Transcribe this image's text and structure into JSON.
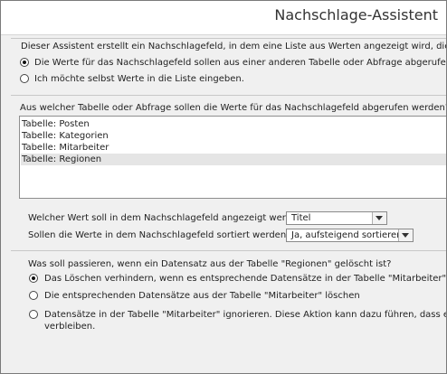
{
  "window": {
    "title": "Nachschlage-Assistent"
  },
  "intro": {
    "text": "Dieser Assistent erstellt ein Nachschlagefeld, in dem eine Liste aus Werten angezeigt wird, die Sie",
    "options": [
      {
        "label": "Die Werte für das Nachschlagefeld sollen aus einer anderen Tabelle oder Abfrage abgerufen werden.",
        "checked": true
      },
      {
        "label": "Ich möchte selbst Werte in die Liste eingeben.",
        "checked": false
      }
    ]
  },
  "source": {
    "question": "Aus welcher Tabelle oder Abfrage sollen die Werte für das Nachschlagefeld abgerufen werden?",
    "items": [
      "Tabelle: Posten",
      "Tabelle: Kategorien",
      "Tabelle: Mitarbeiter",
      "Tabelle: Regionen"
    ],
    "selected_index": 3
  },
  "display": {
    "value_label": "Welcher Wert soll in dem Nachschlagefeld angezeigt werden?",
    "value_selected": "Titel",
    "sort_label": "Sollen die Werte in dem Nachschlagefeld sortiert werden?",
    "sort_selected": "Ja, aufsteigend sortieren"
  },
  "delete": {
    "question": "Was soll passieren, wenn ein Datensatz aus der Tabelle \"Regionen\" gelöscht ist?",
    "options": [
      {
        "label": "Das Löschen verhindern, wenn es entsprechende Datensätze in der Tabelle \"Mitarbeiter\"gibt",
        "checked": true
      },
      {
        "label": "Die entsprechenden Datensätze aus der Tabelle \"Mitarbeiter\" löschen",
        "checked": false
      },
      {
        "label": "Datensätze in der Tabelle \"Mitarbeiter\" ignorieren. Diese Aktion kann dazu führen, dass einige Date",
        "label_line2": "verbleiben.",
        "checked": false
      }
    ]
  }
}
